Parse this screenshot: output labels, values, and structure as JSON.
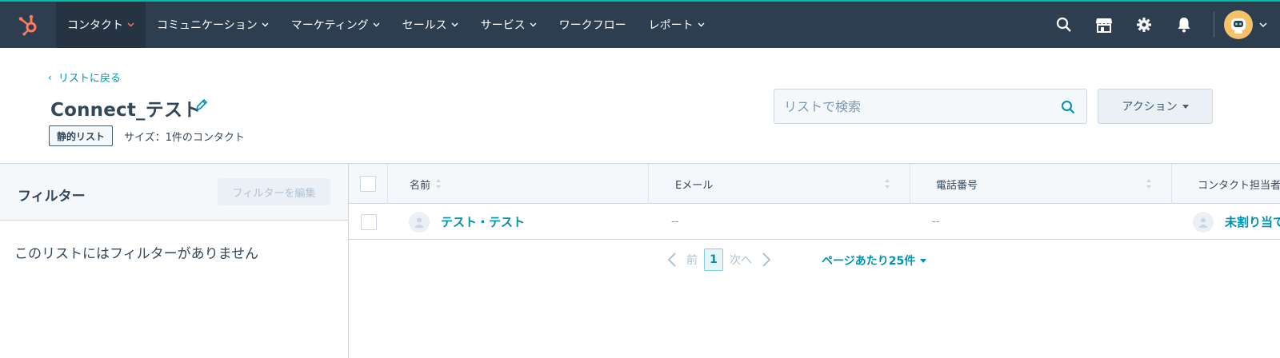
{
  "nav": {
    "items": [
      {
        "label": "コンタクト",
        "active": true
      },
      {
        "label": "コミュニケーション",
        "active": false
      },
      {
        "label": "マーケティング",
        "active": false
      },
      {
        "label": "セールス",
        "active": false
      },
      {
        "label": "サービス",
        "active": false
      },
      {
        "label": "ワークフロー",
        "active": false
      },
      {
        "label": "レポート",
        "active": false
      }
    ],
    "icons": [
      "search-icon",
      "marketplace-icon",
      "settings-icon",
      "notifications-icon"
    ],
    "accent": "#ff7a59",
    "background": "#2d3e50"
  },
  "header": {
    "back_label": "リストに戻る",
    "title": "Connect_テスト",
    "badge": "静的リスト",
    "size_text": "サイズ：1件のコンタクト",
    "search_placeholder": "リストで検索",
    "action_label": "アクション"
  },
  "filters": {
    "title": "フィルター",
    "edit_label": "フィルターを編集",
    "empty_text": "このリストにはフィルターがありません"
  },
  "table": {
    "columns": [
      "名前",
      "Eメール",
      "電話番号",
      "コンタクト担当者"
    ],
    "rows": [
      {
        "name": "テスト・テスト",
        "email": "--",
        "phone": "--",
        "owner": "未割り当て"
      }
    ]
  },
  "pagination": {
    "prev_label": "前",
    "current_page": "1",
    "next_label": "次へ",
    "per_page_label": "ページあたり25件"
  }
}
